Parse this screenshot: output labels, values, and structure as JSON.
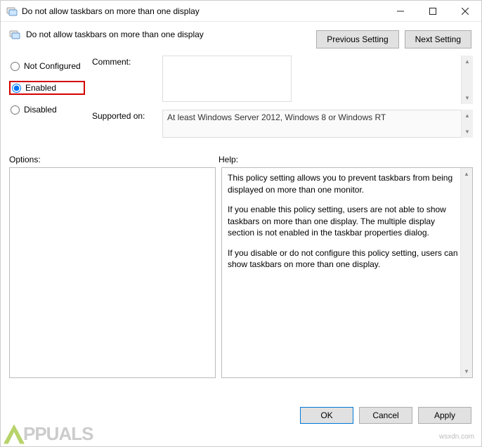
{
  "window": {
    "title": "Do not allow taskbars on more than one display"
  },
  "header": {
    "subtitle": "Do not allow taskbars on more than one display",
    "prev_btn": "Previous Setting",
    "next_btn": "Next Setting"
  },
  "radios": {
    "not_configured": "Not Configured",
    "enabled": "Enabled",
    "disabled": "Disabled",
    "selected": "enabled"
  },
  "fields": {
    "comment_label": "Comment:",
    "comment_value": "",
    "supported_label": "Supported on:",
    "supported_value": "At least Windows Server 2012, Windows 8 or Windows RT"
  },
  "labels": {
    "options": "Options:",
    "help": "Help:"
  },
  "help": {
    "p1": "This policy setting allows you to prevent taskbars from being displayed on more than one monitor.",
    "p2": "If you enable this policy setting, users are not able to show taskbars on more than one display. The multiple display section is not enabled in the taskbar properties dialog.",
    "p3": "If you disable or do not configure this policy setting, users can show taskbars on more than one display."
  },
  "footer": {
    "ok": "OK",
    "cancel": "Cancel",
    "apply": "Apply"
  },
  "watermark": {
    "right": "wsxdn.com",
    "left": "PPUALS"
  }
}
